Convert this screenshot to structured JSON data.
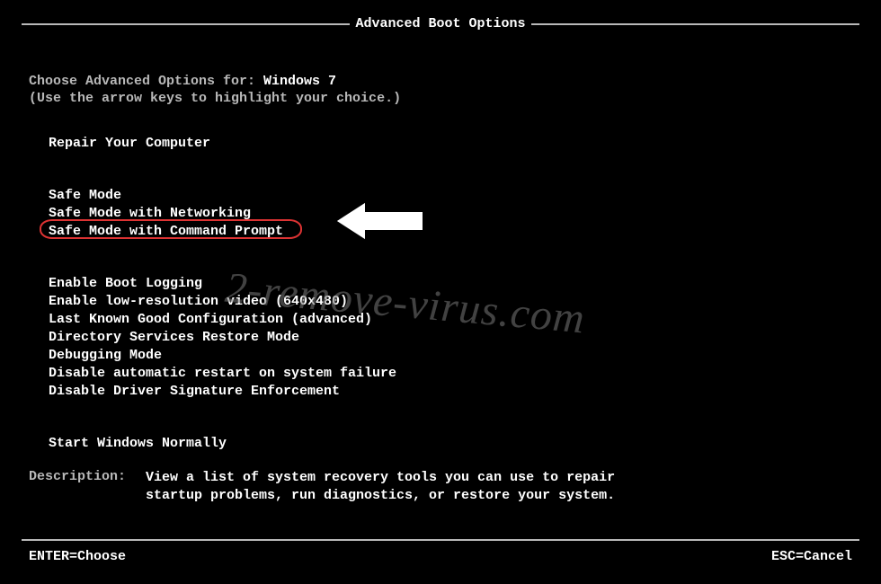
{
  "title": "Advanced Boot Options",
  "intro": {
    "prefix": "Choose Advanced Options for: ",
    "os": "Windows 7",
    "hint": "(Use the arrow keys to highlight your choice.)"
  },
  "groups": [
    {
      "items": [
        "Repair Your Computer"
      ]
    },
    {
      "items": [
        "Safe Mode",
        "Safe Mode with Networking",
        "Safe Mode with Command Prompt"
      ]
    },
    {
      "items": [
        "Enable Boot Logging",
        "Enable low-resolution video (640x480)",
        "Last Known Good Configuration (advanced)",
        "Directory Services Restore Mode",
        "Debugging Mode",
        "Disable automatic restart on system failure",
        "Disable Driver Signature Enforcement"
      ]
    },
    {
      "items": [
        "Start Windows Normally"
      ]
    }
  ],
  "highlighted": "Safe Mode with Command Prompt",
  "description": {
    "label": "Description:",
    "text": "View a list of system recovery tools you can use to repair startup problems, run diagnostics, or restore your system."
  },
  "footer": {
    "enter": "ENTER=Choose",
    "esc": "ESC=Cancel"
  },
  "watermark": "2-remove-virus.com"
}
